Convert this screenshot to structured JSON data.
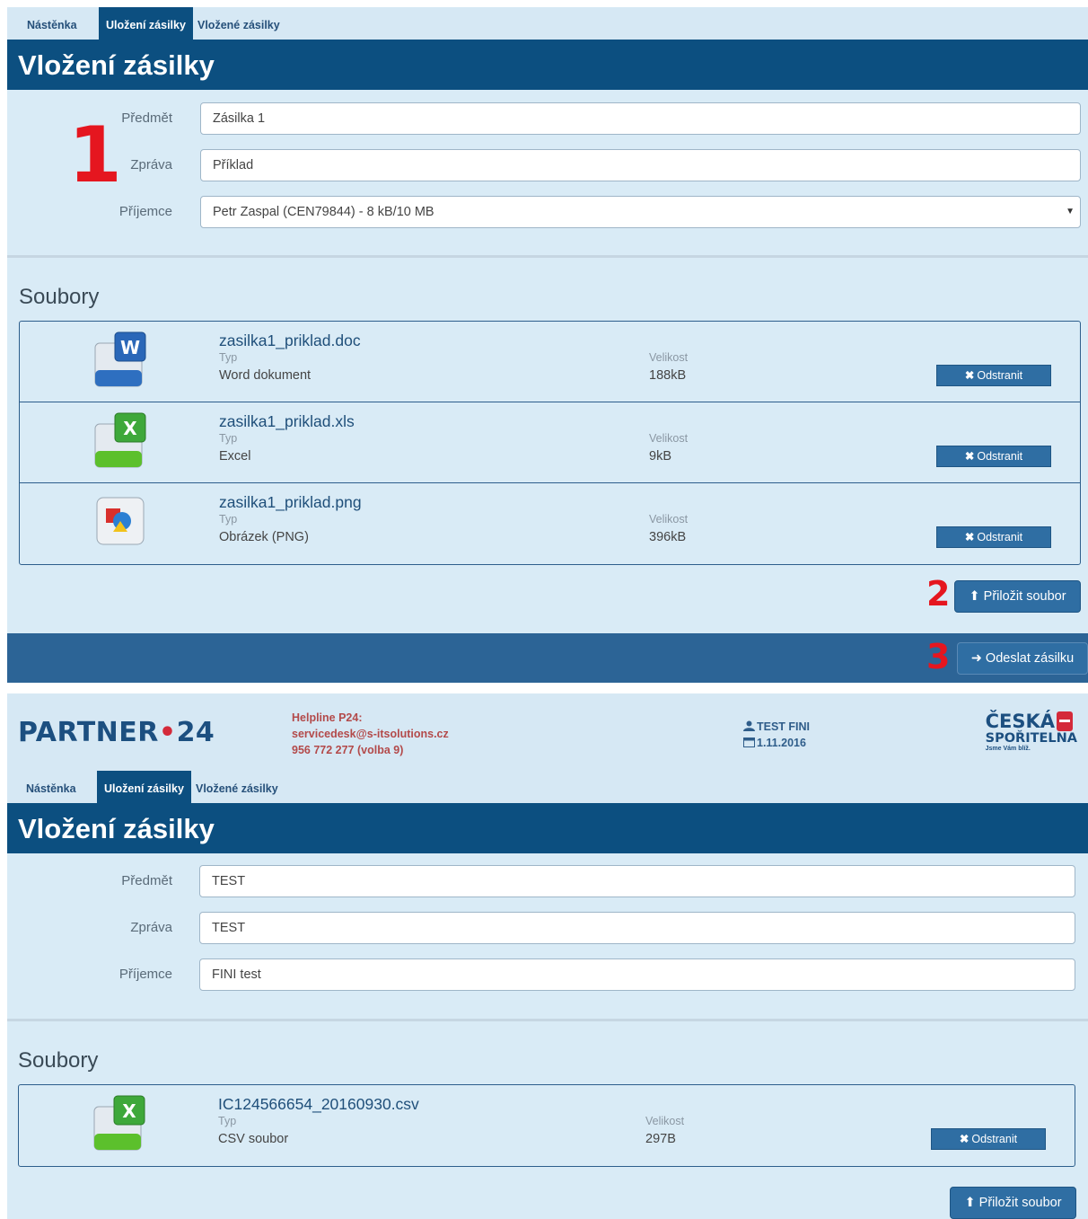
{
  "shot1": {
    "tabs": [
      "Nástěnka",
      "Uložení zásilky",
      "Vložené zásilky"
    ],
    "title": "Vložení zásilky",
    "form": {
      "subject_label": "Předmět",
      "subject_value": "Zásilka 1",
      "message_label": "Zpráva",
      "message_value": "Příklad",
      "recipient_label": "Příjemce",
      "recipient_value": "Petr Zaspal (CEN79844) - 8 kB/10 MB",
      "recipient_caret": "▼"
    },
    "files_heading": "Soubory",
    "files": [
      {
        "name": "zasilka1_priklad.doc",
        "type_label": "Typ",
        "type": "Word dokument",
        "size_label": "Velikost",
        "size": "188kB",
        "remove": "Odstranit",
        "icon": "word-file-icon"
      },
      {
        "name": "zasilka1_priklad.xls",
        "type_label": "Typ",
        "type": "Excel",
        "size_label": "Velikost",
        "size": "9kB",
        "remove": "Odstranit",
        "icon": "excel-file-icon"
      },
      {
        "name": "zasilka1_priklad.png",
        "type_label": "Typ",
        "type": "Obrázek (PNG)",
        "size_label": "Velikost",
        "size": "396kB",
        "remove": "Odstranit",
        "icon": "image-file-icon"
      }
    ],
    "attach_label": "Přiložit soubor",
    "send_label": "Odeslat zásilku",
    "markers": [
      "1",
      "2",
      "3"
    ]
  },
  "shot2": {
    "brand": {
      "part1": "PARTNER",
      "dot": "•",
      "part2": "24"
    },
    "helpline": [
      "Helpline P24:",
      "servicedesk@s-itsolutions.cz",
      "956 772 277 (volba 9)"
    ],
    "user": {
      "name": "TEST FINI",
      "date": "1.11.2016"
    },
    "bank": {
      "line1": "ČESKÁ",
      "line2": "SPOŘITELNA",
      "line3": "Jsme Vám blíž."
    },
    "tabs": [
      "Nástěnka",
      "Uložení zásilky",
      "Vložené zásilky"
    ],
    "title": "Vložení zásilky",
    "form": {
      "subject_label": "Předmět",
      "subject_value": "TEST",
      "message_label": "Zpráva",
      "message_value": "TEST",
      "recipient_label": "Příjemce",
      "recipient_value": "FINI test"
    },
    "files_heading": "Soubory",
    "files": [
      {
        "name": "IC124566654_20160930.csv",
        "type_label": "Typ",
        "type": "CSV soubor",
        "size_label": "Velikost",
        "size": "297B",
        "remove": "Odstranit",
        "icon": "excel-file-icon"
      }
    ],
    "attach_label": "Přiložit soubor"
  },
  "colors": {
    "primary": "#0c4f80",
    "panel": "#d9ebf6",
    "button": "#2f6ea3",
    "marker": "#e5161f"
  }
}
